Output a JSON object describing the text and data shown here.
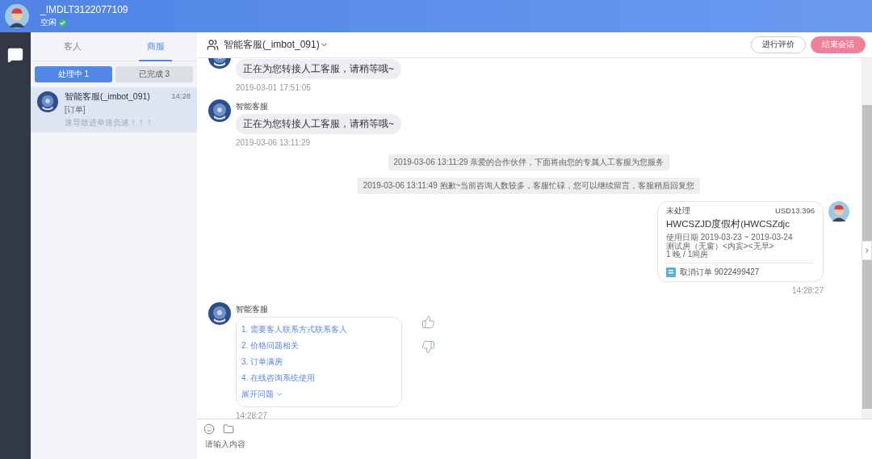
{
  "user": {
    "name": "_IMDLT3122077109",
    "status": "空闲",
    "online": true
  },
  "list_tabs": [
    {
      "label": "客人",
      "selected": false
    },
    {
      "label": "商服",
      "selected": true
    }
  ],
  "filters": [
    {
      "label": "处理中 1",
      "selected": true
    },
    {
      "label": "已完成 3",
      "selected": false
    }
  ],
  "conversations": [
    {
      "name": "智能客服(_imbot_091)",
      "time": "14:28",
      "tag": "[订单]",
      "preview": "速导致进单速负速！！！",
      "selected": true
    }
  ],
  "chat": {
    "title": "智能客服(_imbot_091)",
    "buttons": [
      {
        "label": "进行评价",
        "kind": "outline"
      },
      {
        "label": "结束会话",
        "kind": "primary"
      }
    ]
  },
  "messages": [
    {
      "kind": "bot",
      "text": "正在为您转接人工客服，请稍等哦~",
      "time": "2019-03-01 17:51:05"
    },
    {
      "kind": "bot",
      "sender": "智能客服",
      "text": "正在为您转接人工客服，请稍等哦~",
      "time": "2019-03-06 13:11:29"
    },
    {
      "kind": "system",
      "text": "2019-03-06 13:11:29 亲爱的合作伙伴，下面将由您的专属人工客服为您服务"
    },
    {
      "kind": "system",
      "text": "2019-03-06 13:11:49 抱歉~当前咨询人数较多，客服忙碌，您可以继续留言，客服稍后回复您"
    },
    {
      "kind": "order",
      "status": "未处理",
      "price": "USD13.396",
      "hotel": "HWCSZJD度假村(HWCSZdjc",
      "dates": "使用日期 2019-03-23 ~ 2019-03-24",
      "room": "测试房（无窗）<内宾><无早>",
      "nights": "1 晚 / 1间房",
      "order": "取消订单 9022499427",
      "time": "14:28:27"
    },
    {
      "kind": "menu",
      "sender": "智能客服",
      "items": [
        "1. 需要客人联系方式联系客人",
        "2. 价格问题相关",
        "3. 订单满房",
        "4. 在线咨询系统使用"
      ],
      "expand": "展开问题",
      "time": "14:28:27"
    }
  ],
  "composer": {
    "placeholder": "请输入内容"
  }
}
